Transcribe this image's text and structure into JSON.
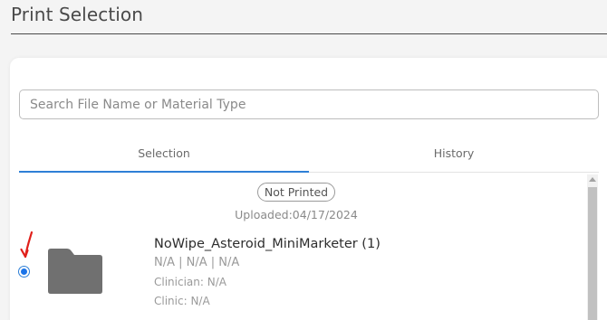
{
  "header": {
    "title": "Print Selection"
  },
  "search": {
    "placeholder": "Search File Name or Material Type",
    "value": ""
  },
  "tabs": [
    {
      "label": "Selection",
      "active": true
    },
    {
      "label": "History",
      "active": false
    }
  ],
  "file": {
    "status": "Not Printed",
    "uploaded": "Uploaded:04/17/2024",
    "name": "NoWipe_Asteroid_MiniMarketer (1)",
    "meta": "N/A | N/A | N/A",
    "clinician": "Clinician: N/A",
    "clinic": "Clinic: N/A",
    "selected": true,
    "icon": "folder-icon"
  },
  "colors": {
    "accent": "#2e7fd6",
    "annotation": "#e0201b",
    "folder": "#707070"
  }
}
